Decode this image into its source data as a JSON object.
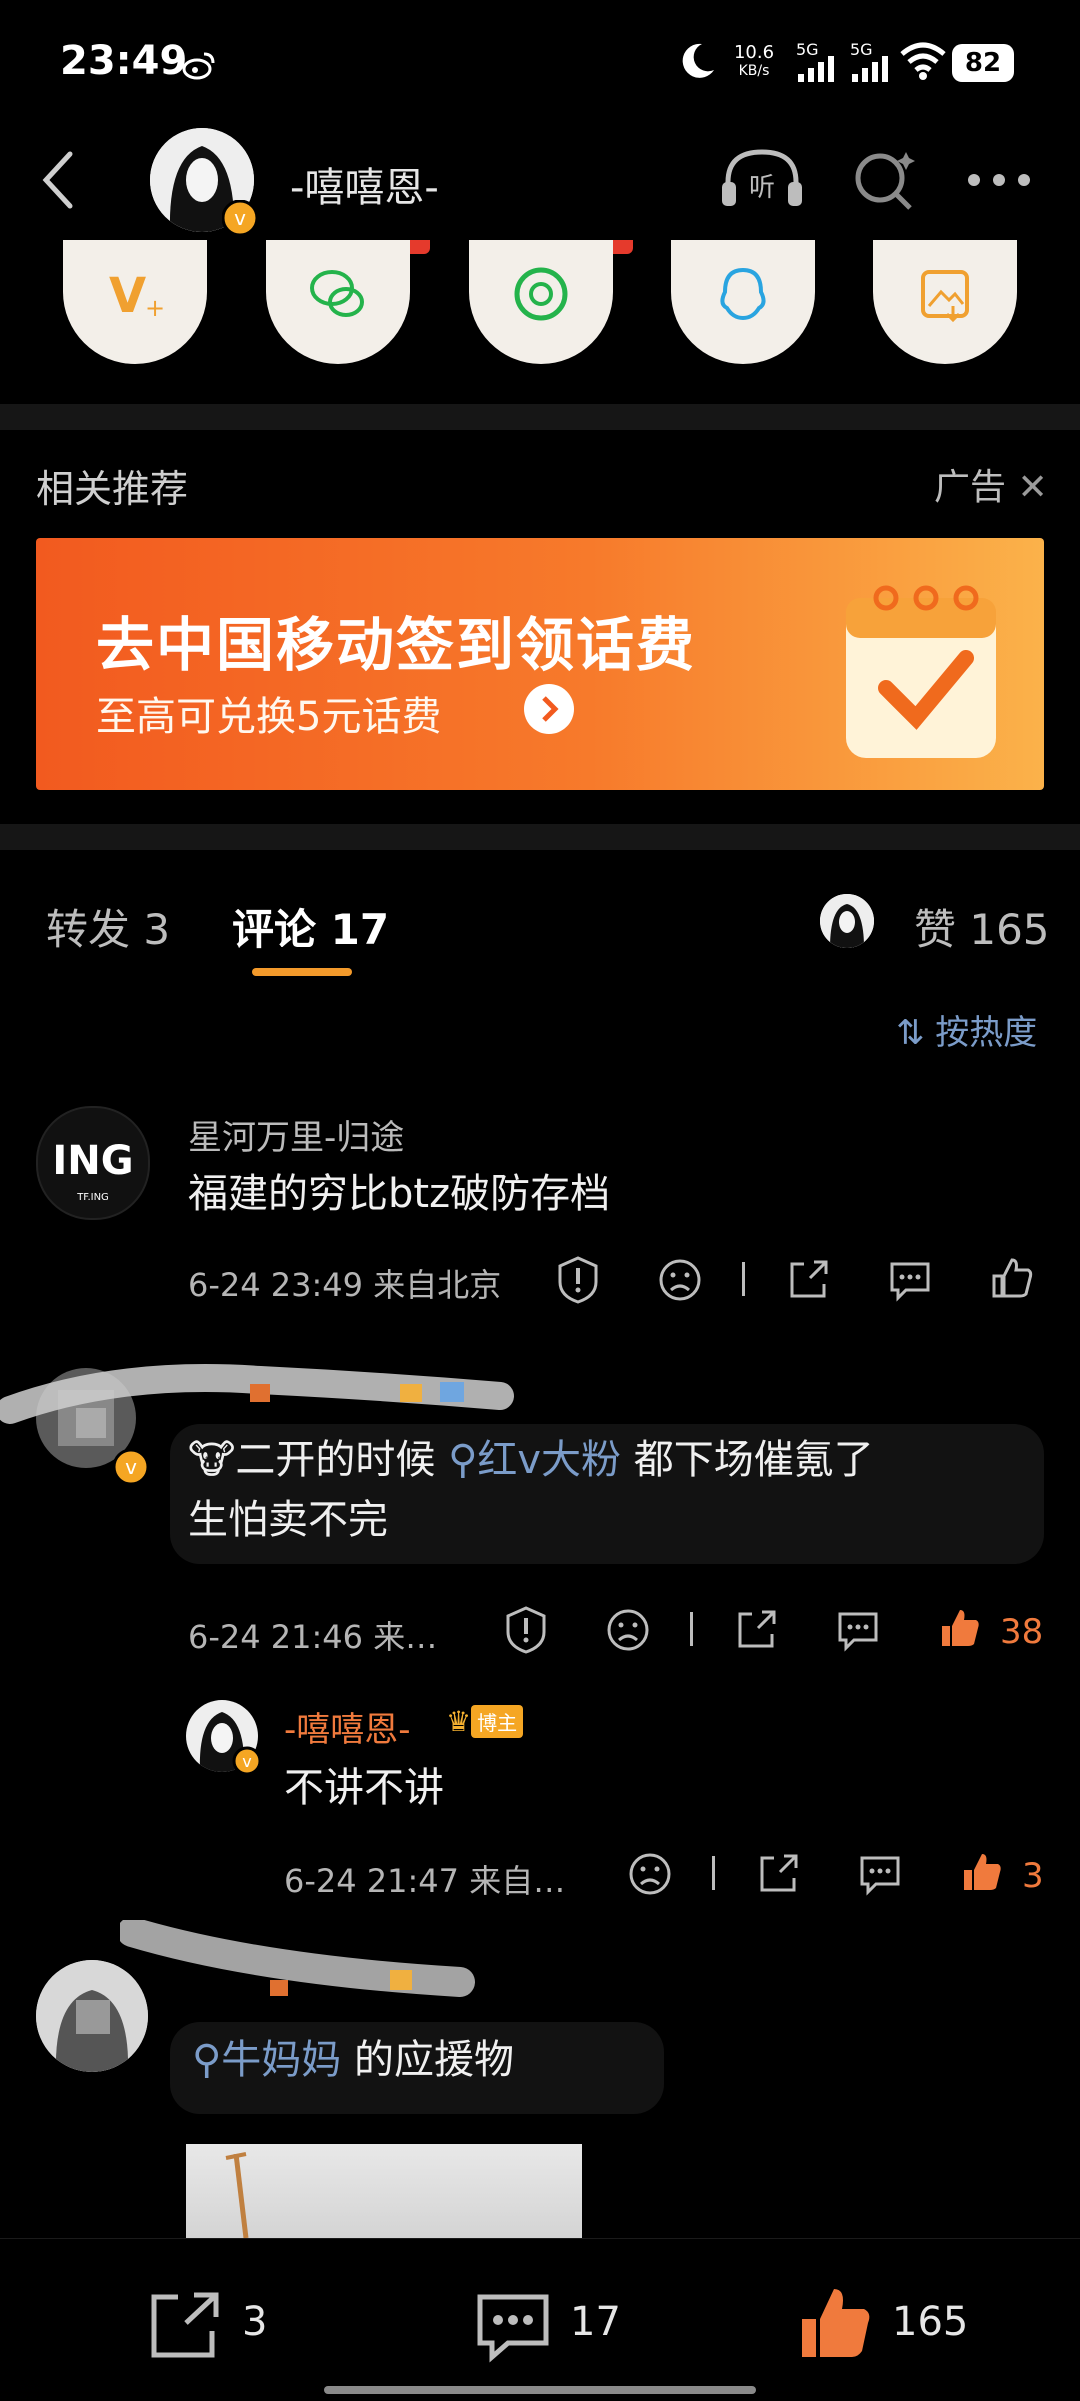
{
  "status_bar": {
    "time": "23:49",
    "net_speed": "10.6",
    "net_unit": "KB/s",
    "signal_1": "5G",
    "signal_2": "5G",
    "battery": "82"
  },
  "header": {
    "title": "-嘻嘻恩-"
  },
  "share_items": [
    "vplus-icon",
    "wechat-icon",
    "moments-icon",
    "qq-icon",
    "save-image-icon"
  ],
  "recommend": {
    "label": "相关推荐",
    "ad_label": "广告"
  },
  "banner": {
    "headline": "去中国移动签到领话费",
    "subline": "至高可兑换5元话费"
  },
  "tabs": {
    "repost": "转发 3",
    "comments": "评论 17",
    "likes": "赞 165"
  },
  "sort_label": "按热度",
  "comments": [
    {
      "name": "星河万里-归途",
      "text": "福建的穷比btz破防存档",
      "meta": "6-24 23:49  来自北京"
    },
    {
      "text_before": "二开的时候 ",
      "mention": "红v大粉",
      "text_after": " 都下场催氪了",
      "line2": "生怕卖不完",
      "meta": "6-24 21:46  来…",
      "likes": "38"
    },
    {
      "name": "-嘻嘻恩-",
      "badge": "博主",
      "text": "不讲不讲",
      "meta": "6-24 21:47  来自…",
      "likes": "3"
    },
    {
      "mention": "牛妈妈",
      "text_after": " 的应援物"
    }
  ],
  "bottom_bar": {
    "reposts": "3",
    "comments": "17",
    "likes": "165"
  },
  "colors": {
    "accent": "#f39a2b",
    "mention": "#7b9cc9",
    "like": "#f07a3d",
    "banner": "#f25a1f"
  }
}
